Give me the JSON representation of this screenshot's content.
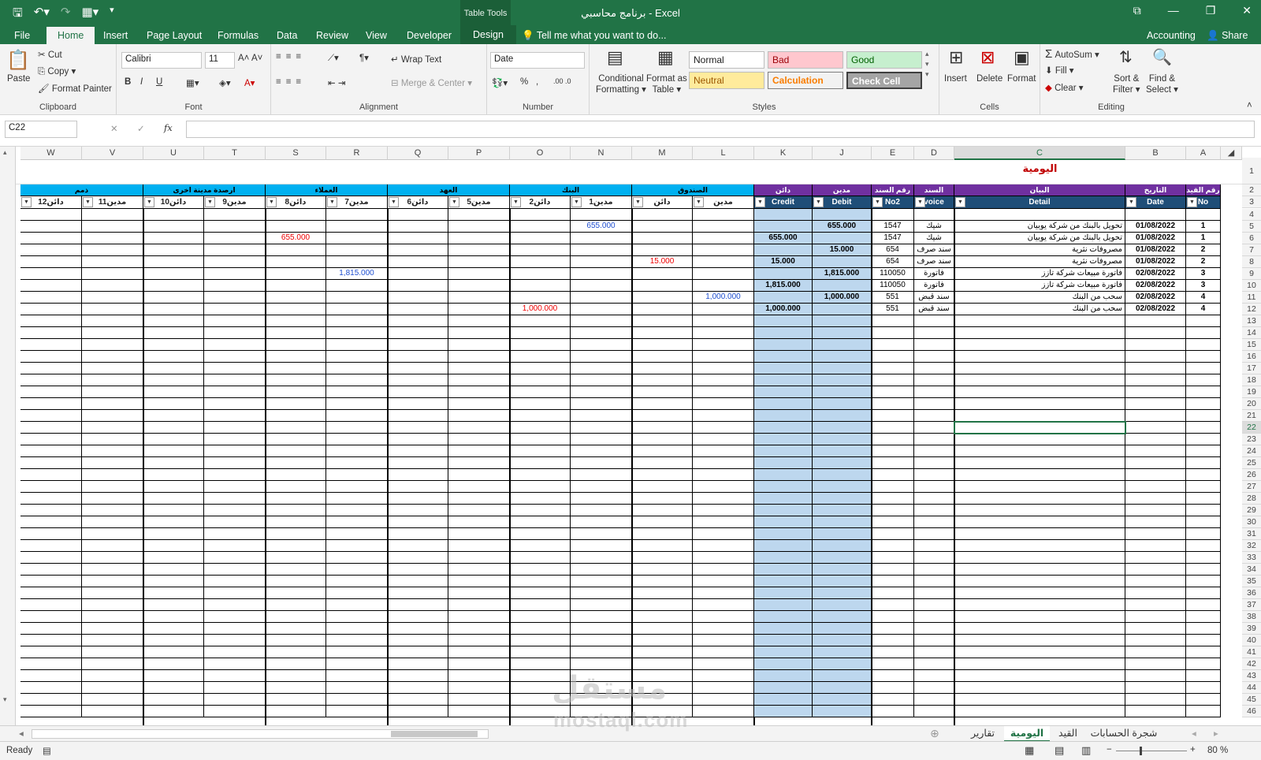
{
  "window": {
    "title": "برنامج محاسبي - Excel",
    "context_tab": "Table Tools",
    "account": "Accounting",
    "share": "Share"
  },
  "tabs": [
    "File",
    "Home",
    "Insert",
    "Page Layout",
    "Formulas",
    "Data",
    "Review",
    "View",
    "Developer",
    "Design"
  ],
  "tell_me": "Tell me what you want to do...",
  "ribbon": {
    "clipboard": {
      "paste": "Paste",
      "cut": "Cut",
      "copy": "Copy",
      "painter": "Format Painter",
      "label": "Clipboard"
    },
    "font": {
      "name": "Calibri",
      "size": "11",
      "label": "Font",
      "bold": "B",
      "italic": "I",
      "underline": "U"
    },
    "alignment": {
      "wrap": "Wrap Text",
      "merge": "Merge & Center",
      "label": "Alignment"
    },
    "number": {
      "format": "Date",
      "percent": "%",
      "comma": ",",
      "label": "Number"
    },
    "styles": {
      "cond": "Conditional",
      "cond2": "Formatting",
      "fmt_table": "Format as",
      "fmt_table2": "Table",
      "normal": "Normal",
      "bad": "Bad",
      "good": "Good",
      "neutral": "Neutral",
      "calculation": "Calculation",
      "check": "Check Cell",
      "label": "Styles"
    },
    "cells": {
      "insert": "Insert",
      "delete": "Delete",
      "format": "Format",
      "label": "Cells"
    },
    "editing": {
      "autosum": "AutoSum",
      "fill": "Fill",
      "clear": "Clear",
      "sort": "Sort &",
      "sort2": "Filter",
      "find": "Find &",
      "find2": "Select",
      "label": "Editing"
    }
  },
  "formula_bar": {
    "name_box": "C22",
    "fx": "fx",
    "cancel": "✕",
    "enter": "✓"
  },
  "sheet": {
    "title": "اليومية",
    "columns": [
      "W",
      "V",
      "U",
      "T",
      "S",
      "R",
      "Q",
      "P",
      "O",
      "N",
      "M",
      "L",
      "K",
      "J",
      "E",
      "D",
      "C",
      "B",
      "A"
    ],
    "header_main": {
      "A": "رقم القيد",
      "B": "التاريخ",
      "C": "البيان",
      "D": "السند",
      "E": "رقم السند",
      "J": "مدين",
      "K": "دائن"
    },
    "header_en": {
      "A": "No",
      "B": "Date",
      "C": "Detail",
      "D": "voice",
      "E": "No2",
      "J": "Debit",
      "K": "Credit"
    },
    "groups": [
      "الصندوق",
      "البنك",
      "العهد",
      "العملاء",
      "ارصدة مدينة اخرى",
      "ذمم"
    ],
    "sub_headers": [
      "مدين",
      "دائن",
      "مدين1",
      "دائن2",
      "مدين5",
      "دائن6",
      "مدين7",
      "دائن8",
      "مدين9",
      "دائن10",
      "مدين11",
      "دائن12"
    ],
    "rows": [
      {
        "no": "1",
        "date": "01/08/2022",
        "detail": "تحويل بالبنك من شركة يوبيان",
        "voucher": "شيك",
        "no2": "1547",
        "debit": "655.000",
        "credit": "",
        "side": {
          "col": "N",
          "value": "655.000",
          "color": "blue"
        }
      },
      {
        "no": "1",
        "date": "01/08/2022",
        "detail": "تحويل بالبنك من شركة يوبيان",
        "voucher": "شيك",
        "no2": "1547",
        "debit": "",
        "credit": "655.000",
        "side": {
          "col": "S",
          "value": "655.000",
          "color": "red"
        }
      },
      {
        "no": "2",
        "date": "01/08/2022",
        "detail": "مصروفات نثرية",
        "voucher": "سند صرف",
        "no2": "654",
        "debit": "15.000",
        "credit": "",
        "side": null
      },
      {
        "no": "2",
        "date": "01/08/2022",
        "detail": "مصروفات نثرية",
        "voucher": "سند صرف",
        "no2": "654",
        "debit": "",
        "credit": "15.000",
        "side": {
          "col": "M",
          "value": "15.000",
          "color": "red"
        }
      },
      {
        "no": "3",
        "date": "02/08/2022",
        "detail": "فاتورة مبيعات شركة تازز",
        "voucher": "فاتورة",
        "no2": "110050",
        "debit": "1,815.000",
        "credit": "",
        "side": {
          "col": "R",
          "value": "1,815.000",
          "color": "blue"
        }
      },
      {
        "no": "3",
        "date": "02/08/2022",
        "detail": "فاتورة مبيعات شركة تازز",
        "voucher": "فاتورة",
        "no2": "110050",
        "debit": "",
        "credit": "1,815.000",
        "side": null
      },
      {
        "no": "4",
        "date": "02/08/2022",
        "detail": "سحب من البنك",
        "voucher": "سند قبض",
        "no2": "551",
        "debit": "1,000.000",
        "credit": "",
        "side": {
          "col": "L",
          "value": "1,000.000",
          "color": "blue"
        }
      },
      {
        "no": "4",
        "date": "02/08/2022",
        "detail": "سحب من البنك",
        "voucher": "سند قبض",
        "no2": "551",
        "debit": "",
        "credit": "1,000.000",
        "side": {
          "col": "O",
          "value": "1,000.000",
          "color": "red"
        }
      }
    ],
    "row_numbers_start": 1,
    "row_numbers_end": 46,
    "selected_row": "22"
  },
  "sheet_tabs": [
    "تقارير",
    "اليومية",
    "القيد",
    "شجرة الحسابات"
  ],
  "active_sheet": "اليومية",
  "status": {
    "ready": "Ready",
    "zoom": "80 %"
  },
  "watermark": {
    "ar": "مستقل",
    "en": "mostaql.com"
  },
  "colors": {
    "excel_green": "#217346",
    "header_blue": "#00b0f0",
    "header_purple": "#7030a0",
    "header_navy": "#1f4e78",
    "col_fill": "#bdd7ee",
    "title_red": "#c00000"
  }
}
